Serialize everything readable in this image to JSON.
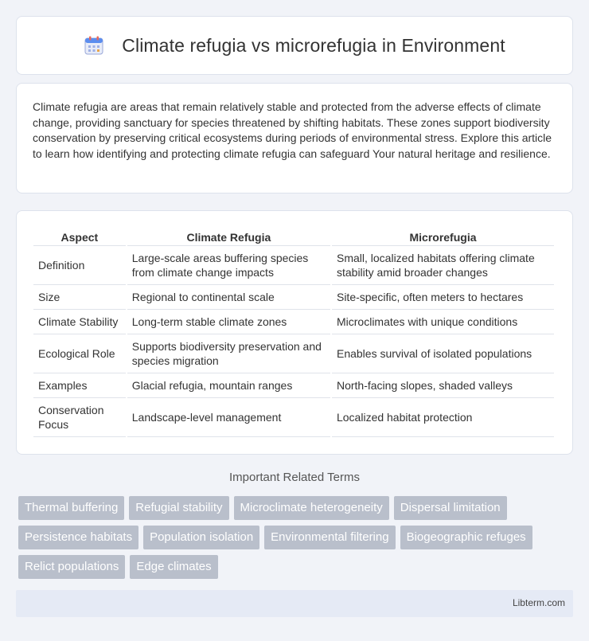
{
  "header": {
    "title": "Climate refugia vs microrefugia in Environment",
    "icon": "calendar-icon"
  },
  "intro": {
    "text": "Climate refugia are areas that remain relatively stable and protected from the adverse effects of climate change, providing sanctuary for species threatened by shifting habitats. These zones support biodiversity conservation by preserving critical ecosystems during periods of environmental stress. Explore this article to learn how identifying and protecting climate refugia can safeguard Your natural heritage and resilience."
  },
  "table": {
    "headers": [
      "Aspect",
      "Climate Refugia",
      "Microrefugia"
    ],
    "rows": [
      [
        "Definition",
        "Large-scale areas buffering species from climate change impacts",
        "Small, localized habitats offering climate stability amid broader changes"
      ],
      [
        "Size",
        "Regional to continental scale",
        "Site-specific, often meters to hectares"
      ],
      [
        "Climate Stability",
        "Long-term stable climate zones",
        "Microclimates with unique conditions"
      ],
      [
        "Ecological Role",
        "Supports biodiversity preservation and species migration",
        "Enables survival of isolated populations"
      ],
      [
        "Examples",
        "Glacial refugia, mountain ranges",
        "North-facing slopes, shaded valleys"
      ],
      [
        "Conservation Focus",
        "Landscape-level management",
        "Localized habitat protection"
      ]
    ]
  },
  "related": {
    "heading": "Important Related Terms",
    "terms": [
      "Thermal buffering",
      "Refugial stability",
      "Microclimate heterogeneity",
      "Dispersal limitation",
      "Persistence habitats",
      "Population isolation",
      "Environmental filtering",
      "Biogeographic refuges",
      "Relict populations",
      "Edge climates"
    ]
  },
  "footer": {
    "site": "Libterm.com"
  },
  "colors": {
    "tag_bg": "#b9bfcb",
    "footer_bg": "#e5eaf5",
    "page_bg": "#f1f3f8"
  }
}
